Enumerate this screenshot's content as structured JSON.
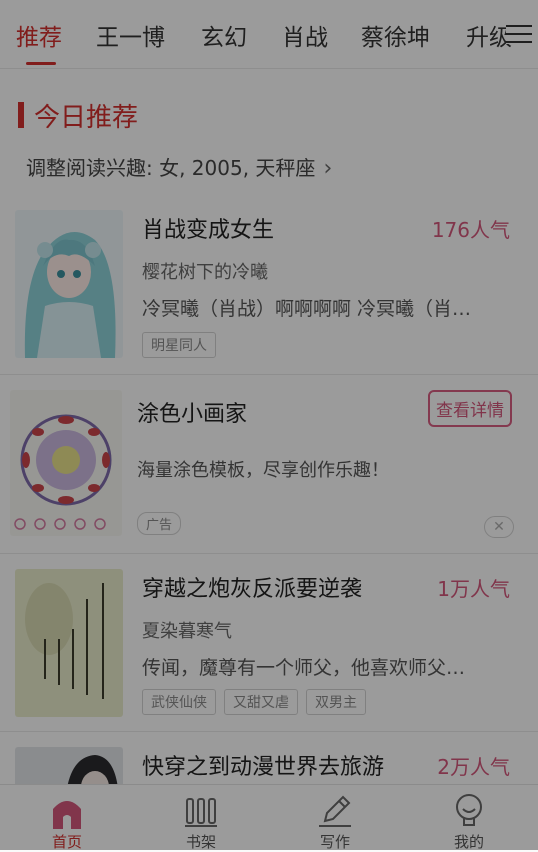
{
  "tabs": [
    "推荐",
    "王一博",
    "玄幻",
    "肖战",
    "蔡徐坤",
    "升级"
  ],
  "section": {
    "title": "今日推荐",
    "interest_text": "调整阅读兴趣: 女, 2005, 天秤座"
  },
  "books": [
    {
      "title": "肖战变成女生",
      "popularity": "176人气",
      "author": "樱花树下的冷曦",
      "desc": "冷冥曦（肖战）啊啊啊啊 冷冥曦（肖…",
      "tags": [
        "明星同人"
      ]
    },
    {
      "title": "穿越之炮灰反派要逆袭",
      "popularity": "1万人气",
      "author": "夏染暮寒气",
      "desc": "传闻，魔尊有一个师父，他喜欢师父…",
      "tags": [
        "武侠仙侠",
        "又甜又虐",
        "双男主"
      ]
    },
    {
      "title": "快穿之到动漫世界去旅游",
      "popularity": "2万人气"
    }
  ],
  "ad": {
    "title": "涂色小画家",
    "desc": "海量涂色模板，尽享创作乐趣！",
    "button": "查看详情",
    "badge": "广告",
    "close": "✕"
  },
  "bottom_nav": [
    {
      "label": "首页",
      "icon": "home-icon",
      "active": true
    },
    {
      "label": "书架",
      "icon": "bookshelf-icon",
      "active": false
    },
    {
      "label": "写作",
      "icon": "pen-icon",
      "active": false
    },
    {
      "label": "我的",
      "icon": "profile-icon",
      "active": false
    }
  ],
  "colors": {
    "accent": "#d0302e",
    "popularity": "#d0567a"
  }
}
